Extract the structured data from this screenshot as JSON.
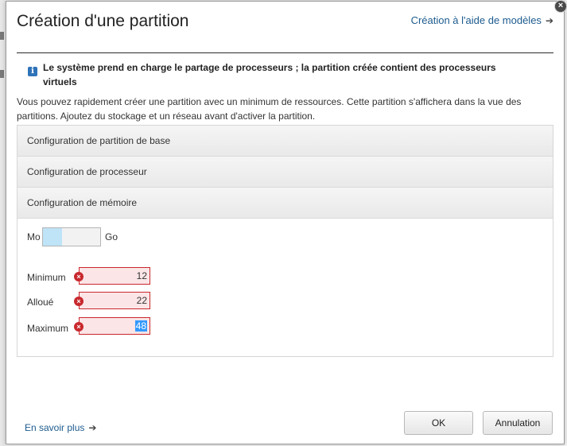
{
  "dialog": {
    "title": "Création d'une partition",
    "template_link": "Création à l'aide de modèles",
    "close_glyph": "×"
  },
  "info": {
    "icon_glyph": "i",
    "message": "Le système prend en charge le partage de processeurs ; la partition créée contient des processeurs virtuels"
  },
  "description": "Vous pouvez rapidement créer une partition avec un minimum de ressources. Cette partition s'affichera dans la vue des partitions. Ajoutez du stockage et un réseau avant d'activer la partition.",
  "accordion": {
    "sections": [
      {
        "label": "Configuration de partition de base"
      },
      {
        "label": "Configuration de processeur"
      },
      {
        "label": "Configuration de mémoire"
      }
    ]
  },
  "memory": {
    "unit_left": "Mo",
    "unit_right": "Go",
    "fields": [
      {
        "label": "Minimum",
        "value": "12"
      },
      {
        "label": "Alloué",
        "value": "22"
      },
      {
        "label": "Maximum",
        "value": "48"
      }
    ],
    "error_glyph": "×"
  },
  "footer": {
    "learn_more": "En savoir plus",
    "ok_label": "OK",
    "cancel_label": "Annulation"
  },
  "icons": {
    "arrow_glyph": "➔"
  },
  "colors": {
    "link": "#1d5b8f",
    "error": "#c8282d",
    "error_bg": "#fbe5e7",
    "info": "#2f73b8",
    "toggle_accent": "#bfe3f7"
  }
}
